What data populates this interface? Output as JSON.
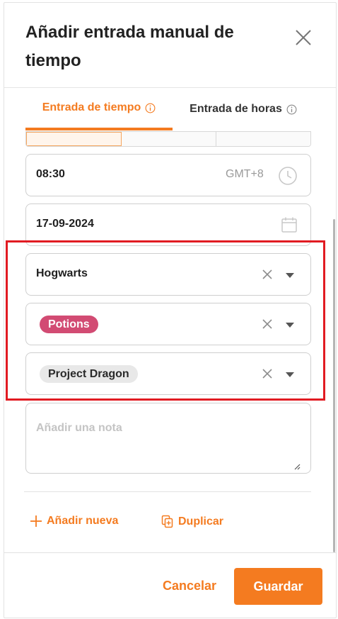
{
  "dialog": {
    "title": "Añadir entrada manual de tiempo"
  },
  "tabs": [
    {
      "label": "Entrada de tiempo",
      "active": true
    },
    {
      "label": "Entrada de horas",
      "active": false
    }
  ],
  "time_field": {
    "value": "08:30",
    "timezone": "GMT+8"
  },
  "date_field": {
    "value": "17-09-2024"
  },
  "project_select": {
    "value": "Hogwarts"
  },
  "task_select": {
    "tag": "Potions"
  },
  "tag_select": {
    "tag": "Project Dragon"
  },
  "note": {
    "placeholder": "Añadir una nota"
  },
  "actions": {
    "add_new": "Añadir nueva",
    "duplicate": "Duplicar"
  },
  "footer": {
    "cancel": "Cancelar",
    "save": "Guardar"
  },
  "colors": {
    "accent": "#f47b20",
    "task_tag": "#d24b73",
    "highlight": "#e11b22"
  }
}
